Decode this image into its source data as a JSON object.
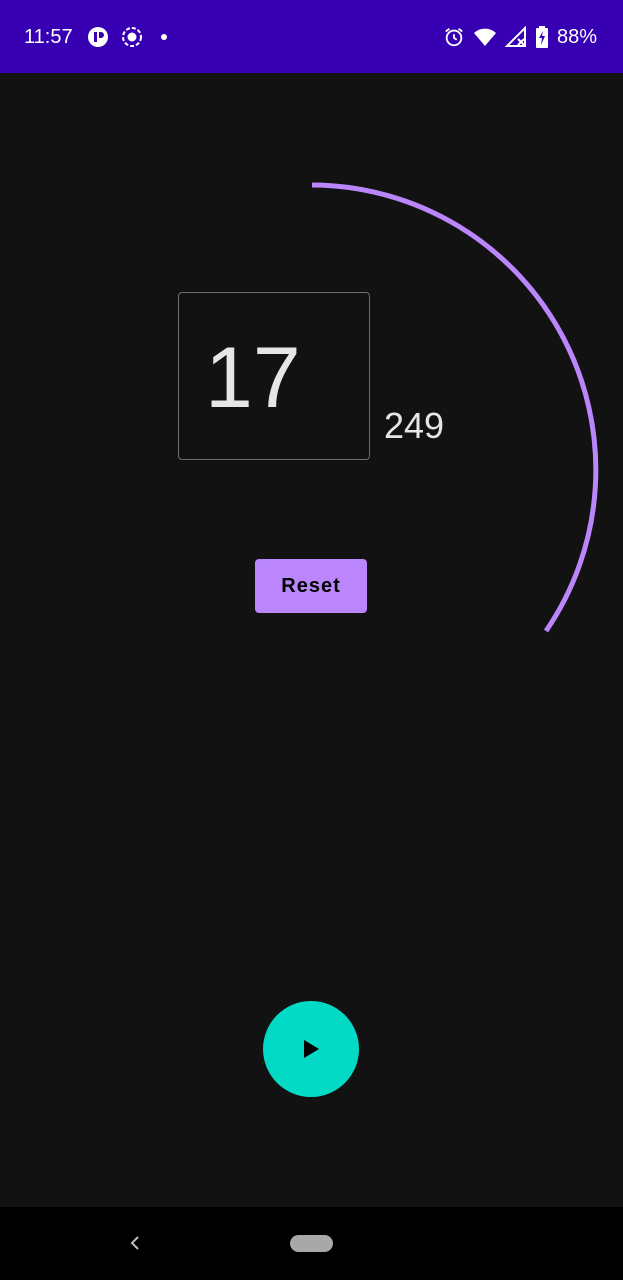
{
  "status_bar": {
    "time": "11:57",
    "battery_percent": "88%",
    "left_icons": [
      "app-notification-icon",
      "screen-record-icon",
      "dot-icon"
    ],
    "right_icons": [
      "alarm-icon",
      "wifi-icon",
      "cell-signal-icon",
      "battery-charging-icon"
    ],
    "background_color": "#3700b3"
  },
  "counter": {
    "value": "17",
    "secondary_value": "249",
    "arc_color": "#bb86fc"
  },
  "actions": {
    "reset_label": "Reset",
    "play_icon": "play-icon",
    "play_color": "#03dac5"
  },
  "navigation": {
    "back_icon": "back-chevron-icon",
    "home_icon": "home-pill-icon"
  }
}
